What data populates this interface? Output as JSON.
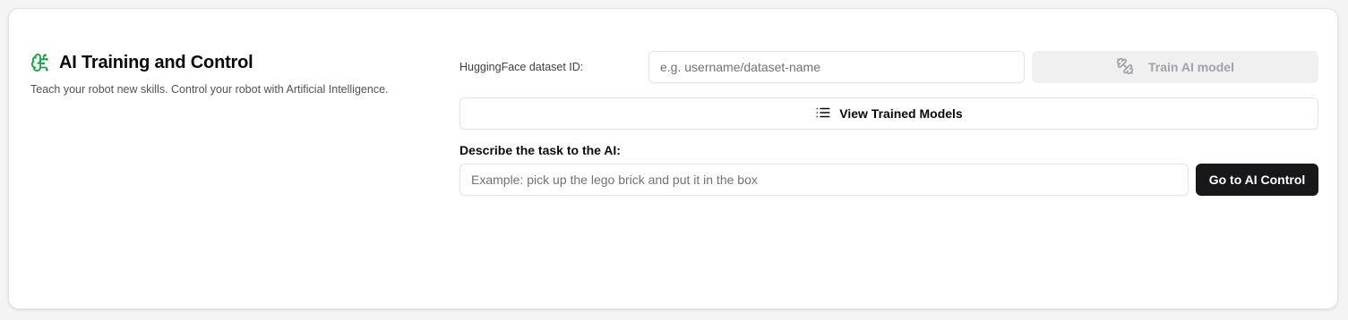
{
  "header": {
    "title": "AI Training and Control",
    "subtitle": "Teach your robot new skills. Control your robot with Artificial Intelligence.",
    "icon": "brain-icon",
    "icon_color": "#16a34a"
  },
  "training": {
    "dataset_label": "HuggingFace dataset ID:",
    "dataset_placeholder": "e.g. username/dataset-name",
    "dataset_value": "",
    "train_button": {
      "label": "Train AI model",
      "icon": "dumbbell-icon",
      "disabled": true
    },
    "view_models_button": {
      "label": "View Trained Models",
      "icon": "list-icon"
    }
  },
  "control": {
    "task_label": "Describe the task to the AI:",
    "task_placeholder": "Example: pick up the lego brick and put it in the box",
    "task_value": "",
    "go_button_label": "Go to AI Control"
  },
  "colors": {
    "primary_button": "#18181b",
    "disabled_button": "#f0f0f1",
    "accent": "#16a34a"
  }
}
